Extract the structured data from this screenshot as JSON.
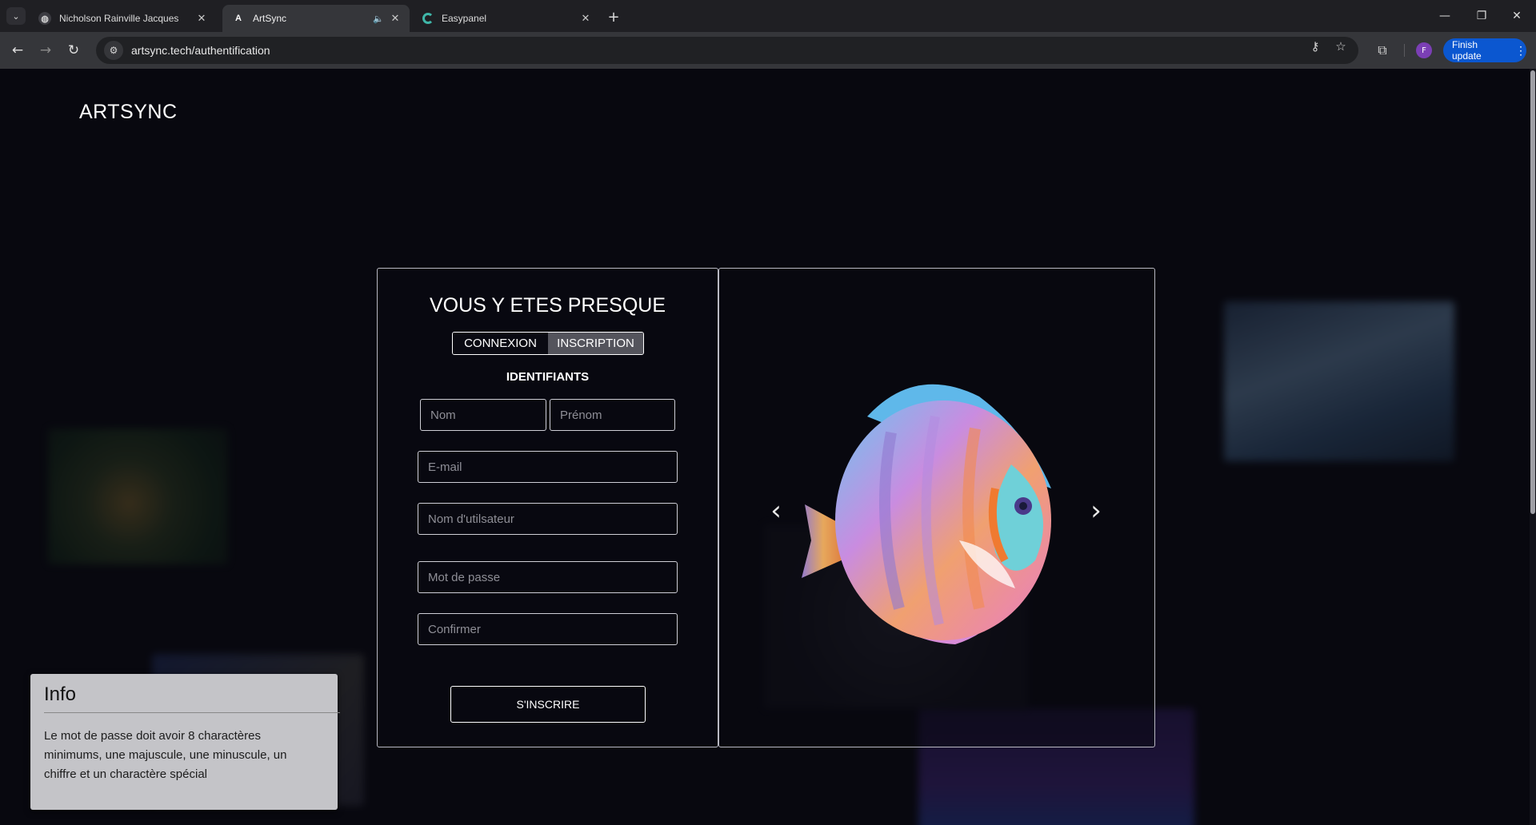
{
  "browser": {
    "tabs": [
      {
        "title": "Nicholson Rainville Jacques",
        "active": false
      },
      {
        "title": "ArtSync",
        "active": true
      },
      {
        "title": "Easypanel",
        "active": false
      }
    ],
    "url": "artsync.tech/authentification",
    "avatar_letter": "F",
    "finish_update_label": "Finish update"
  },
  "page": {
    "logo": "ARTSYNC",
    "form": {
      "title": "VOUS Y ETES PRESQUE",
      "toggle": {
        "login": "CONNEXION",
        "signup": "INSCRIPTION",
        "selected": "signup"
      },
      "section_label": "IDENTIFIANTS",
      "fields": {
        "nom": "Nom",
        "prenom": "Prénom",
        "email": "E-mail",
        "username": "Nom d'utilsateur",
        "password": "Mot de passe",
        "confirm": "Confirmer"
      },
      "submit_label": "S'INSCRIRE"
    },
    "carousel": {
      "prev_icon": "chevron-left-icon",
      "next_icon": "chevron-right-icon"
    },
    "info_box": {
      "title": "Info",
      "text": "Le mot de passe doit avoir 8 charactères minimums, une majuscule, une minuscule, un chiffre et un charactère spécial"
    }
  },
  "colors": {
    "page_bg": "#08080f",
    "accent": "#0b57d0",
    "toggle_selected": "#54545c",
    "info_bg": "#c4c4c8"
  }
}
